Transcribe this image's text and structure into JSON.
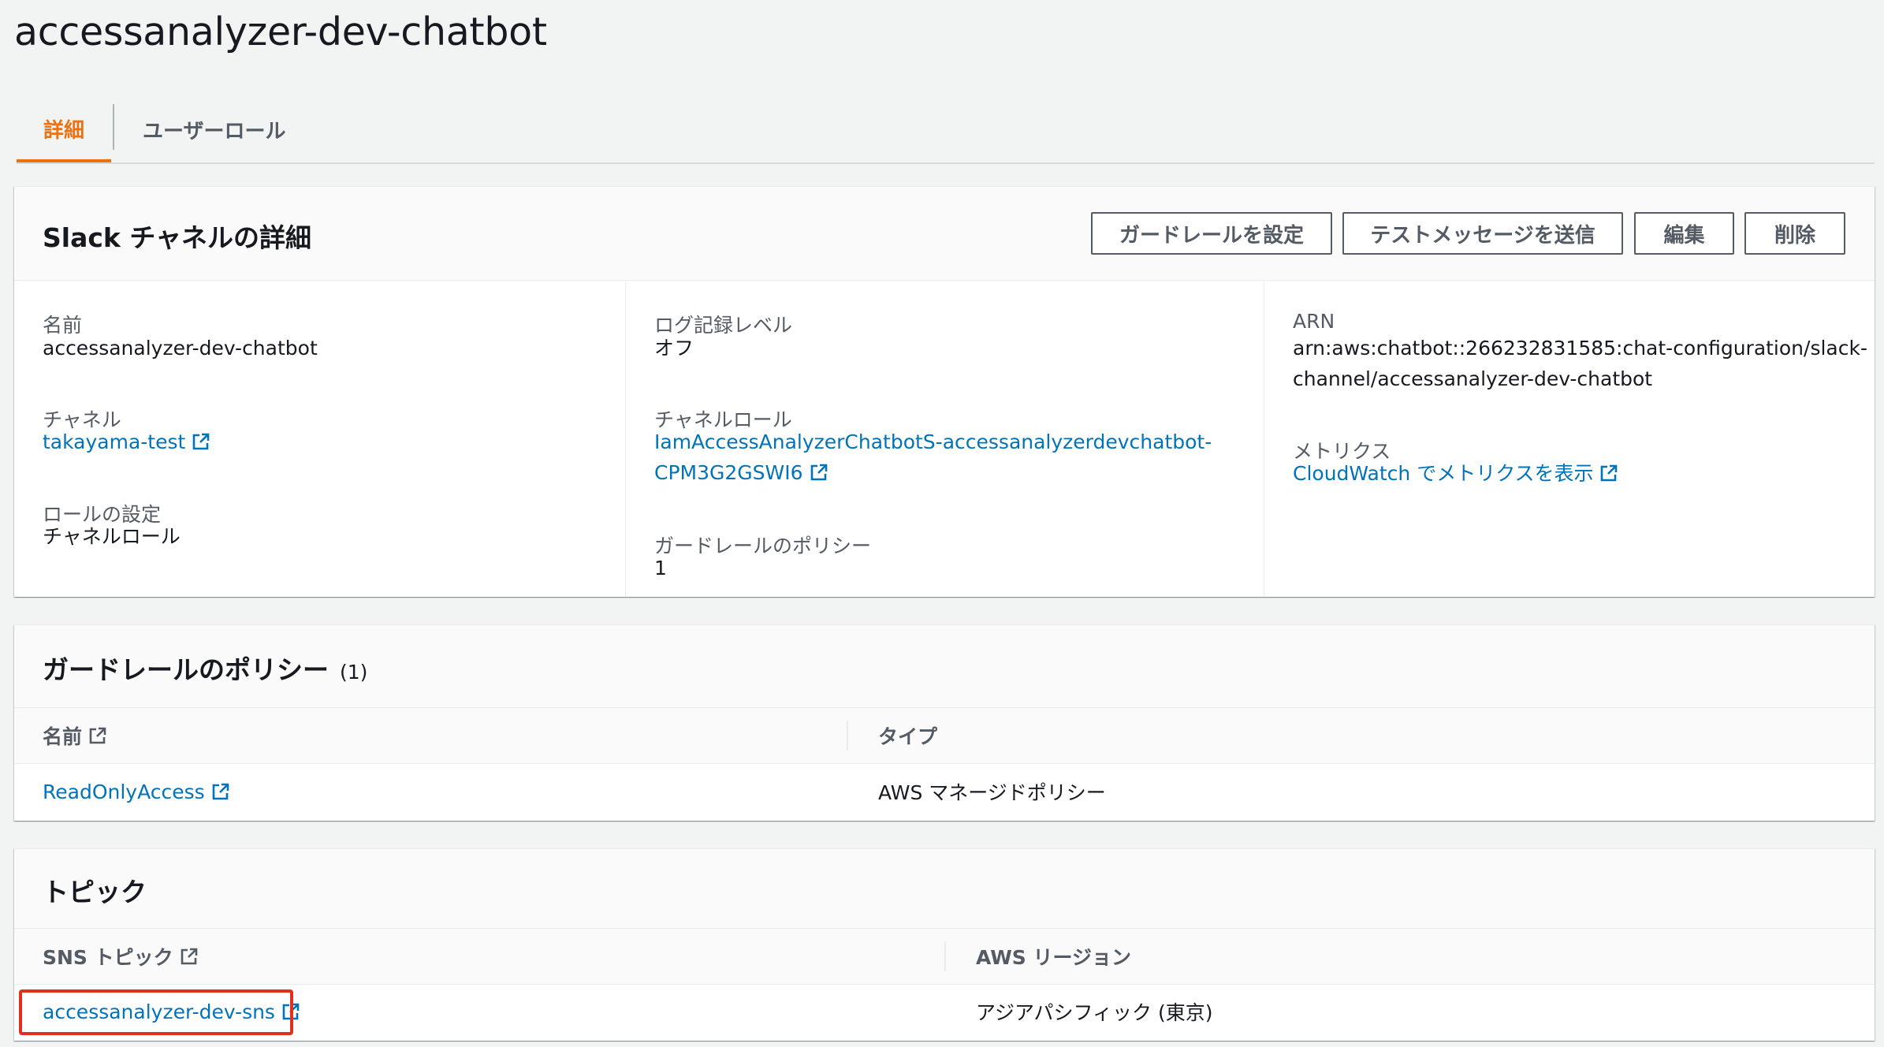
{
  "page": {
    "title": "accessanalyzer-dev-chatbot"
  },
  "tabs": [
    {
      "label": "詳細",
      "active": true
    },
    {
      "label": "ユーザーロール",
      "active": false
    }
  ],
  "details": {
    "title": "Slack チャネルの詳細",
    "buttons": {
      "guardrail": "ガードレールを設定",
      "test_message": "テストメッセージを送信",
      "edit": "編集",
      "delete": "削除"
    },
    "name": {
      "label": "名前",
      "value": "accessanalyzer-dev-chatbot"
    },
    "channel": {
      "label": "チャネル",
      "value": "takayama-test"
    },
    "role_setting": {
      "label": "ロールの設定",
      "value": "チャネルロール"
    },
    "log_level": {
      "label": "ログ記録レベル",
      "value": "オフ"
    },
    "channel_role": {
      "label": "チャネルロール",
      "line1": "IamAccessAnalyzerChatbotS-accessanalyzerdevchatbot-",
      "line2": "CPM3G2GSWI6"
    },
    "guardrail_policies": {
      "label": "ガードレールのポリシー",
      "value": "1"
    },
    "arn": {
      "label": "ARN",
      "line1": "arn:aws:chatbot::266232831585:chat-configuration/slack-",
      "line2": "channel/accessanalyzer-dev-chatbot"
    },
    "metrics": {
      "label": "メトリクス",
      "link": "CloudWatch でメトリクスを表示"
    }
  },
  "guardrail_table": {
    "title": "ガードレールのポリシー",
    "count": "(1)",
    "columns": [
      "名前",
      "タイプ"
    ],
    "rows": [
      {
        "name": "ReadOnlyAccess",
        "type": "AWS マネージドポリシー"
      }
    ]
  },
  "topics_table": {
    "title": "トピック",
    "columns": [
      "SNS トピック",
      "AWS リージョン"
    ],
    "rows": [
      {
        "topic": "accessanalyzer-dev-sns",
        "region": "アジアパシフィック (東京)"
      }
    ]
  },
  "colors": {
    "accent": "#ec7211",
    "link": "#0073bb",
    "highlight": "#e0301e"
  },
  "icons": {
    "external_link": "external-link-icon"
  }
}
